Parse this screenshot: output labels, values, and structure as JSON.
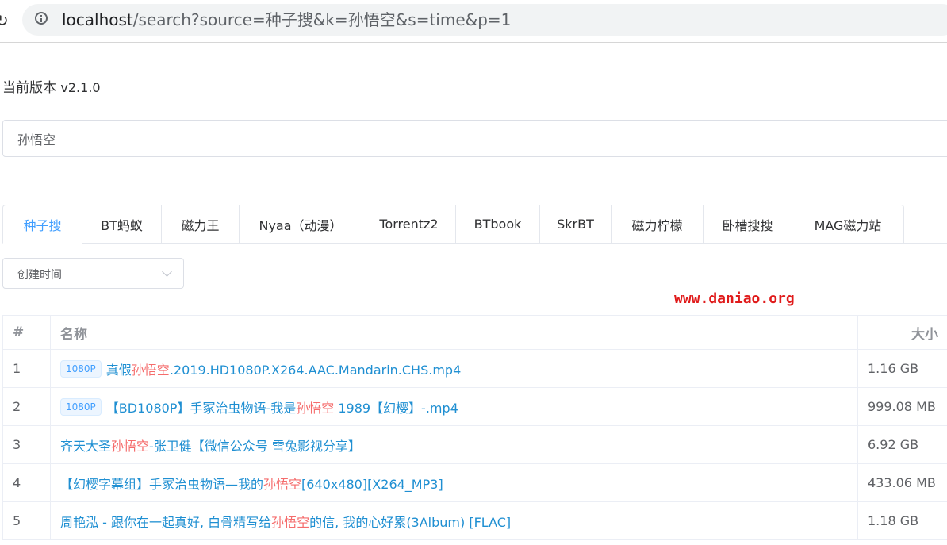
{
  "browser": {
    "url_host": "localhost",
    "url_path": "/search?source=种子搜&k=孙悟空&s=time&p=1"
  },
  "version": {
    "label": "当前版本",
    "number": "v2.1.0"
  },
  "search": {
    "value": "孙悟空"
  },
  "tabs": [
    {
      "label": "种子搜",
      "active": true
    },
    {
      "label": "BT蚂蚁"
    },
    {
      "label": "磁力王"
    },
    {
      "label": "Nyaa（动漫）"
    },
    {
      "label": "Torrentz2"
    },
    {
      "label": "BTbook"
    },
    {
      "label": "SkrBT"
    },
    {
      "label": "磁力柠檬"
    },
    {
      "label": "卧槽搜搜"
    },
    {
      "label": "MAG磁力站"
    }
  ],
  "sort": {
    "selected": "创建时间"
  },
  "watermark": "www.daniao.org",
  "table": {
    "headers": {
      "index": "#",
      "name": "名称",
      "size": "大小"
    },
    "highlight_color": "#f56c6c",
    "link_color": "#1f8fd2",
    "rows": [
      {
        "index": "1",
        "tag": "1080P",
        "name_pre": "真假",
        "name_hl": "孙悟空",
        "name_post": ".2019.HD1080P.X264.AAC.Mandarin.CHS.mp4",
        "size": "1.16 GB"
      },
      {
        "index": "2",
        "tag": "1080P",
        "name_pre": "【BD1080P】手冢治虫物语-我是",
        "name_hl": "孙悟空",
        "name_post": " 1989【幻樱】-.mp4",
        "size": "999.08 MB"
      },
      {
        "index": "3",
        "tag": "",
        "name_pre": "齐天大圣",
        "name_hl": "孙悟空",
        "name_post": "-张卫健【微信公众号 雪兔影视分享】",
        "size": "6.92 GB"
      },
      {
        "index": "4",
        "tag": "",
        "name_pre": "【幻樱字幕组】手冢治虫物语—我的",
        "name_hl": "孙悟空",
        "name_post": "[640x480][X264_MP3]",
        "size": "433.06 MB"
      },
      {
        "index": "5",
        "tag": "",
        "name_pre": "周艳泓 - 跟你在一起真好, 白骨精写给",
        "name_hl": "孙悟空",
        "name_post": "的信, 我的心好累(3Album) [FLAC]",
        "size": "1.18 GB"
      }
    ]
  }
}
